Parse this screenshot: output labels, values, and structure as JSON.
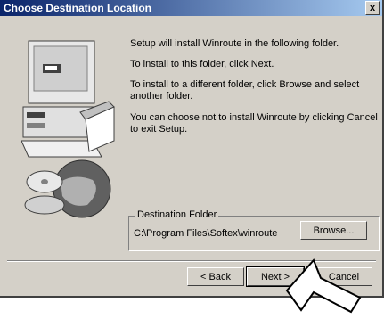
{
  "window": {
    "title": "Choose Destination Location",
    "close_label": "x"
  },
  "messages": {
    "line1": "Setup will install Winroute in the following folder.",
    "line2": "To install to this folder, click Next.",
    "line3": "To install to a different folder, click Browse and select another folder.",
    "line4": "You can choose not to install Winroute by clicking Cancel to exit Setup."
  },
  "destination": {
    "group_label": "Destination Folder",
    "path": "C:\\Program Files\\Softex\\winroute",
    "browse_label": "Browse..."
  },
  "buttons": {
    "back_label": "< Back",
    "next_label": "Next >",
    "cancel_label": "Cancel"
  }
}
